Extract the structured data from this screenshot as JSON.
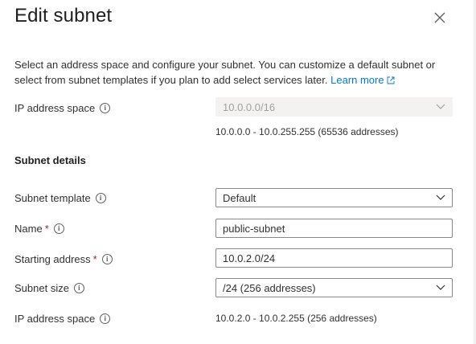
{
  "panel": {
    "title": "Edit subnet",
    "close_icon": "close-icon",
    "description": "Select an address space and configure your subnet. You can customize a default subnet or select from subnet templates if you plan to add select services later.",
    "learn_more": "Learn more"
  },
  "ip_address_space": {
    "label": "IP address space",
    "value": "10.0.0.0/16",
    "range": "10.0.0.0 - 10.0.255.255 (65536 addresses)"
  },
  "subnet_details": {
    "heading": "Subnet details",
    "template": {
      "label": "Subnet template",
      "value": "Default"
    },
    "name": {
      "label": "Name",
      "required_mark": "*",
      "value": "public-subnet"
    },
    "starting_address": {
      "label": "Starting address",
      "required_mark": "*",
      "value": "10.0.2.0/24"
    },
    "subnet_size": {
      "label": "Subnet size",
      "value": "/24 (256 addresses)"
    },
    "ip_address_space": {
      "label": "IP address space",
      "range": "10.0.2.0 - 10.0.2.255 (256 addresses)"
    }
  },
  "colors": {
    "link": "#0078d4",
    "required": "#a4262c",
    "border": "#8a8886",
    "disabled_bg": "#f3f2f1"
  }
}
